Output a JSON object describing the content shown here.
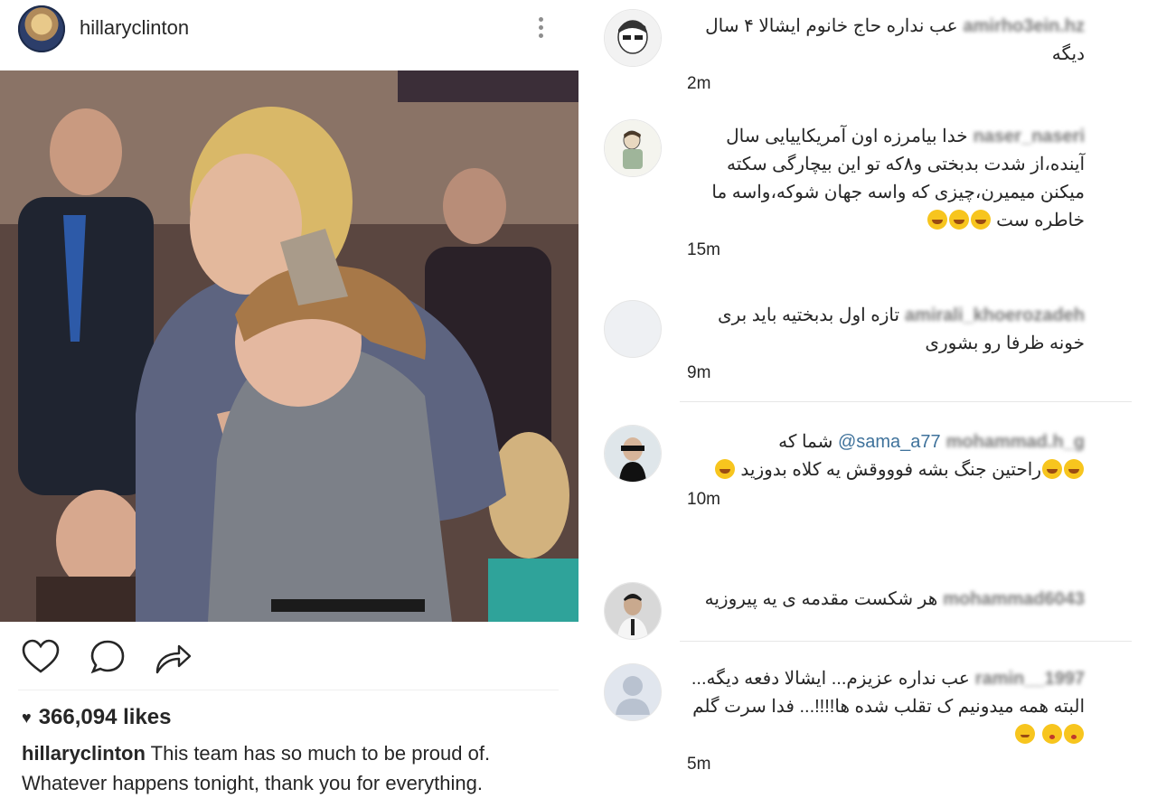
{
  "post": {
    "username": "hillaryclinton",
    "likes": "366,094 likes",
    "caption_user": "hillaryclinton",
    "caption_text": "This team has so much to be proud of. Whatever happens tonight, thank you for everything.",
    "icons": [
      "more-options-icon",
      "heart-icon",
      "comment-icon",
      "share-icon",
      "heart-filled-icon"
    ]
  },
  "comments": [
    {
      "user": "amirho3ein.hz",
      "text": "عب نداره حاج خانوم ایشالا ۴ سال دیگه",
      "time": "2m"
    },
    {
      "user": "naser_naseri",
      "text": "خدا بیامرزه اون آمریکاییایی سال آینده،از شدت بدبختی و۸که تو این بیچارگی سکته میکنن میمیرن،چیزی که واسه جهان شوکه،واسه ما خاطره ست",
      "time": "15m"
    },
    {
      "user": "amirali_khoerozadeh",
      "text": "تازه اول بدبختیه باید بری خونه ظرفا رو بشوری",
      "time": "9m"
    },
    {
      "user": "mohammad.h_g",
      "mention": "@sama_a77",
      "text_a": "شما که",
      "text_b": "راحتین جنگ بشه فوووقش یه کلاه بدوزید",
      "time": "10m"
    },
    {
      "user": "mohammad6043",
      "text": "هر شکست مقدمه ی یه پیروزیه",
      "time": ""
    },
    {
      "user": "ramin__1997",
      "text": "عب نداره عزیزم... ایشالا دفعه دیگه... البته همه میدونیم ک تقلب شده ها!!!!... فدا سرت گلم",
      "time": "5m"
    }
  ]
}
